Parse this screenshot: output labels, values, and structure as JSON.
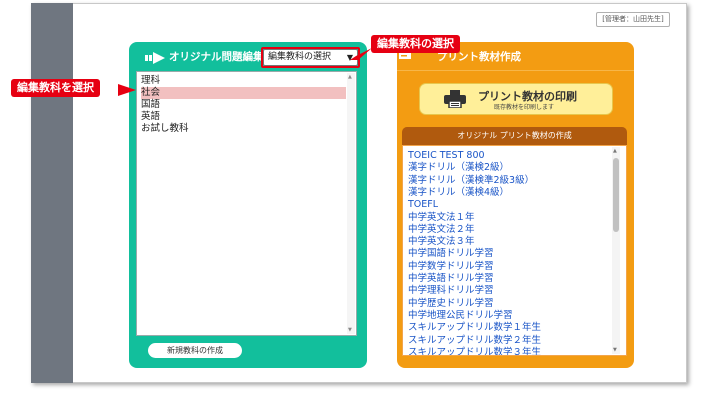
{
  "admin": {
    "label": "[管理者：山田先生]"
  },
  "left_panel": {
    "title": "オリジナル問題編集",
    "subject_select": {
      "value": "編集教科の選択"
    },
    "subjects": [
      {
        "label": "理科",
        "selected": false
      },
      {
        "label": "社会",
        "selected": true
      },
      {
        "label": "国語",
        "selected": false
      },
      {
        "label": "英語",
        "selected": false
      },
      {
        "label": "お試し教科",
        "selected": false
      }
    ],
    "new_subject_button": "新規教科の作成"
  },
  "right_panel": {
    "title": "プリント教材作成",
    "print_button": {
      "label": "プリント教材の印刷",
      "sublabel": "既存教材を印刷します"
    },
    "create_header": "オリジナル プリント教材の作成",
    "materials": [
      "TOEIC TEST 800",
      "漢字ドリル（漢検2級）",
      "漢字ドリル（漢検準2級3級）",
      "漢字ドリル（漢検4級）",
      "TOEFL",
      "中学英文法１年",
      "中学英文法２年",
      "中学英文法３年",
      "中学国語ドリル学習",
      "中学数学ドリル学習",
      "中学英語ドリル学習",
      "中学理科ドリル学習",
      "中学歴史ドリル学習",
      "中学地理公民ドリル学習",
      "スキルアップドリル数学１年生",
      "スキルアップドリル数学２年生",
      "スキルアップドリル数学３年生"
    ]
  },
  "callouts": {
    "top": "編集教科の選択",
    "left": "編集教科を選択"
  },
  "colors": {
    "accent_green": "#12bf9c",
    "accent_orange": "#f39c12",
    "callout_red": "#e60012",
    "link_blue": "#1a55c7",
    "selected_row": "#f2c0c0"
  }
}
